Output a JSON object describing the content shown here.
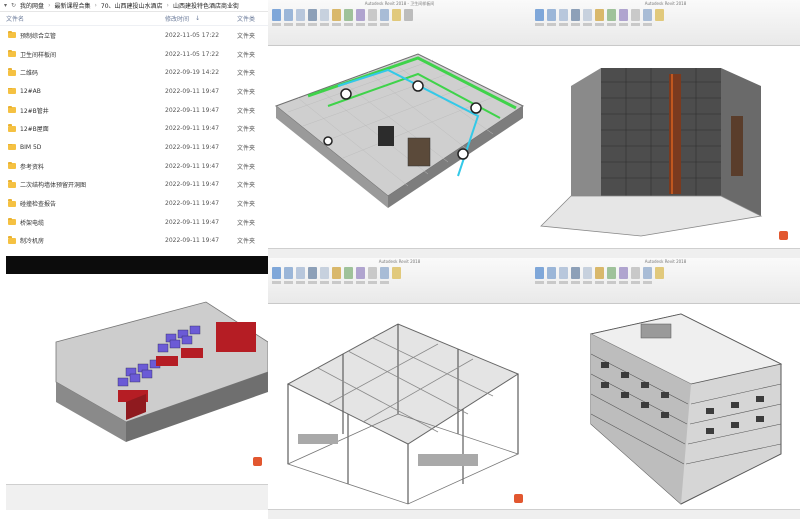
{
  "explorer": {
    "breadcrumb": [
      "我的网盘",
      "最新课程合集",
      "70、山西建投山水酒店",
      "山西建投特色酒店商业街"
    ],
    "columns": {
      "name": "文件名",
      "date": "修改时间",
      "type": "文件类"
    },
    "files": [
      {
        "name": "预制综合立管",
        "date": "2022-11-05 17:22",
        "type": "文件夹"
      },
      {
        "name": "卫生间样板间",
        "date": "2022-11-05 17:22",
        "type": "文件夹"
      },
      {
        "name": "二维码",
        "date": "2022-09-19 14:22",
        "type": "文件夹"
      },
      {
        "name": "12#AB",
        "date": "2022-09-11 19:47",
        "type": "文件夹"
      },
      {
        "name": "12#B管井",
        "date": "2022-09-11 19:47",
        "type": "文件夹"
      },
      {
        "name": "12#B屋面",
        "date": "2022-09-11 19:47",
        "type": "文件夹"
      },
      {
        "name": "BIM 5D",
        "date": "2022-09-11 19:47",
        "type": "文件夹"
      },
      {
        "name": "参考资料",
        "date": "2022-09-11 19:47",
        "type": "文件夹"
      },
      {
        "name": "二次结构墙体预留开洞图",
        "date": "2022-09-11 19:47",
        "type": "文件夹"
      },
      {
        "name": "碰撞检查报告",
        "date": "2022-09-11 19:47",
        "type": "文件夹"
      },
      {
        "name": "桥架电缆",
        "date": "2022-09-11 19:47",
        "type": "文件夹"
      },
      {
        "name": "制冷机房",
        "date": "2022-09-11 19:47",
        "type": "文件夹"
      }
    ]
  },
  "panels": {
    "bathroom_title": "Autodesk Revit 2018 - 卫生间样板间",
    "wall_title": "Autodesk Revit 2018",
    "structure_title": "Autodesk Revit 2018",
    "building_title": "Autodesk Revit 2018"
  },
  "colors": {
    "pipe_green": "#3fd34a",
    "pipe_cyan": "#33c9e8",
    "equipment_red": "#b51d24",
    "equipment_purple": "#6b5bd6",
    "badge_red": "#e2572f"
  }
}
